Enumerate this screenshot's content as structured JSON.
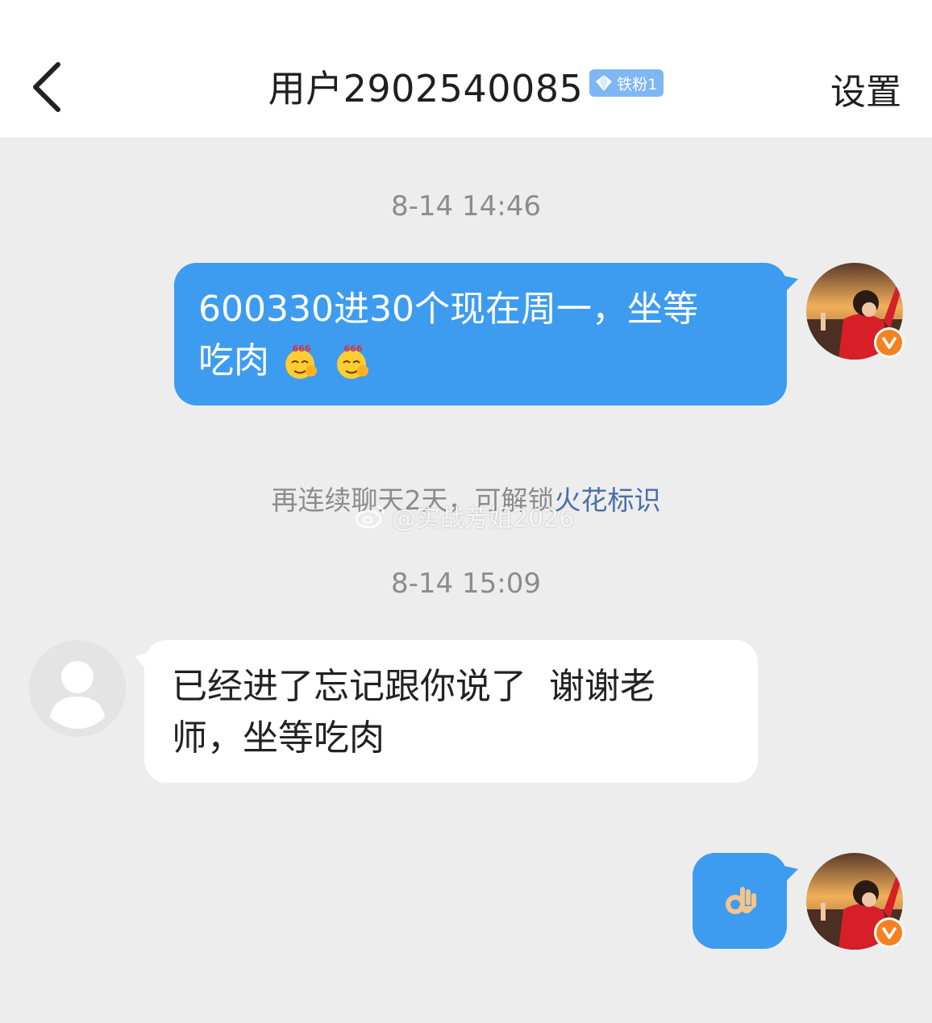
{
  "header": {
    "title": "用户2902540085",
    "badge_label": "铁粉1",
    "settings_label": "设置"
  },
  "messages": {
    "timestamp_1": "8-14 14:46",
    "msg_1": {
      "line1": "600330进30个现在周一，坐等",
      "line2": "吃肉"
    },
    "notice": {
      "text": "再连续聊天2天，可解锁",
      "link": "火花标识"
    },
    "watermark": "@实战芳姐2026",
    "timestamp_2": "8-14 15:09",
    "msg_2": {
      "line1": "已经进了忘记跟你说了  谢谢老",
      "line2": "师，坐等吃肉"
    }
  },
  "icons": [
    "back-arrow-icon",
    "diamond-icon",
    "verified-v-icon",
    "default-user-icon",
    "ok-hand-emoji",
    "666-emoji"
  ],
  "colors": {
    "sent_bubble": "#3d9cf0",
    "received_bubble": "#ffffff",
    "badge": "#7fb6f4",
    "link": "#4a6fa5",
    "verified": "#f5821f"
  }
}
